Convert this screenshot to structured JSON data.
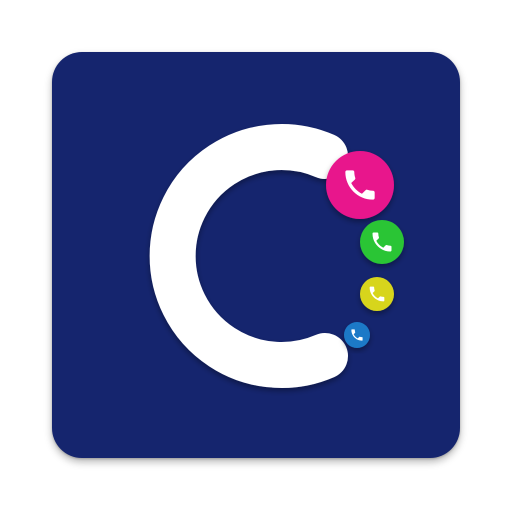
{
  "app_icon": {
    "name": "calls-app-icon",
    "colors": {
      "tile_background": "#15256e",
      "letter": "#ffffff",
      "bubble_large": "#e8138c",
      "bubble_medium": "#2cc535",
      "bubble_small": "#d7d51d",
      "bubble_tiny": "#1c79c7",
      "phone_glyph": "#ffffff"
    },
    "bubbles": [
      {
        "name": "pink-phone-bubble",
        "icon": "phone-icon",
        "color_key": "bubble_large"
      },
      {
        "name": "green-phone-bubble",
        "icon": "phone-icon",
        "color_key": "bubble_medium"
      },
      {
        "name": "yellow-phone-bubble",
        "icon": "phone-icon",
        "color_key": "bubble_small"
      },
      {
        "name": "blue-phone-bubble",
        "icon": "phone-icon",
        "color_key": "bubble_tiny"
      }
    ]
  }
}
